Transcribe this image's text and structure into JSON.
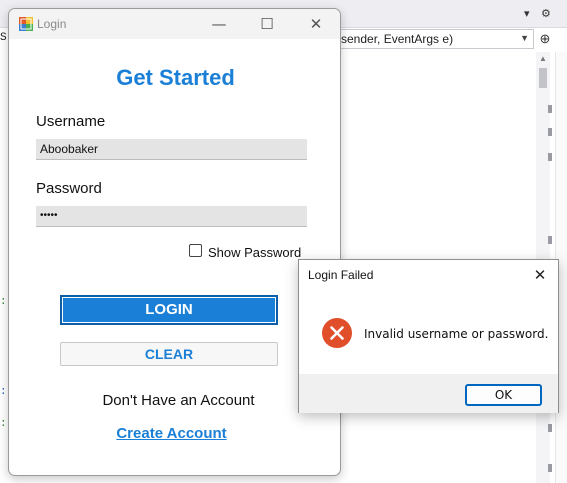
{
  "ide": {
    "method_signature": "sender, EventArgs e)",
    "left_gutter_fragment": "S"
  },
  "login_window": {
    "title": "Login",
    "heading": "Get Started",
    "username_label": "Username",
    "username_value": "Aboobaker",
    "password_label": "Password",
    "password_value": "•••••",
    "show_password_label": "Show Password",
    "show_password_checked": false,
    "login_button": "LOGIN",
    "clear_button": "CLEAR",
    "no_account_text": "Don't Have an Account",
    "create_account_link": "Create Account",
    "colors": {
      "accent": "#1a7fd6",
      "input_bg": "#e4e4e4"
    },
    "icons": [
      "app-icon",
      "minimize-icon",
      "maximize-icon",
      "close-icon"
    ]
  },
  "message_box": {
    "title": "Login Failed",
    "message": "Invalid username or password.",
    "ok_button": "OK",
    "icon": "error-icon",
    "colors": {
      "error": "#e04e2a"
    }
  }
}
